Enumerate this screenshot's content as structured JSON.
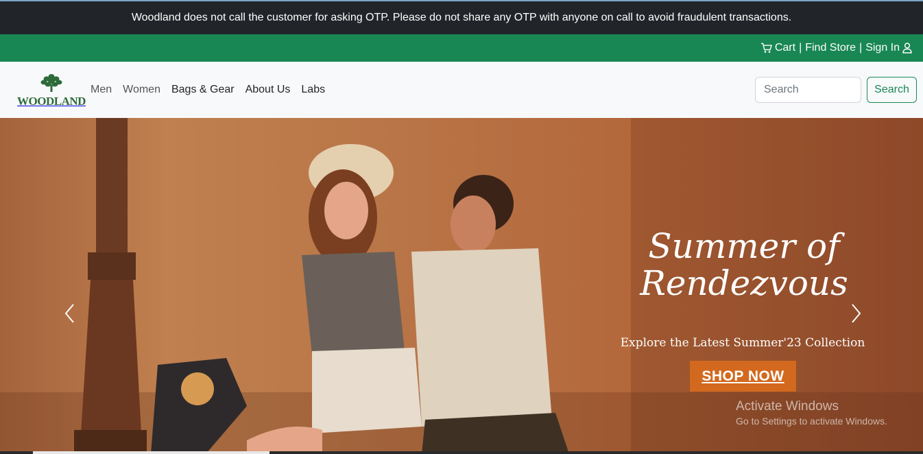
{
  "notice": {
    "text": "Woodland does not call the customer for asking OTP. Please do not share any OTP with anyone on call to avoid fraudulent transactions."
  },
  "account_bar": {
    "cart_label": "Cart",
    "separator": "|",
    "find_store_label": "Find Store",
    "sign_in_label": "Sign In",
    "cart_icon": "cart-icon",
    "user_icon": "user-icon"
  },
  "navbar": {
    "logo_text": "WOODLAND",
    "links": [
      "Men",
      "Women",
      "Bags & Gear",
      "About Us",
      "Labs"
    ]
  },
  "search": {
    "placeholder": "Search",
    "button_label": "Search"
  },
  "carousel": {
    "headline_line1": "Summer of",
    "headline_line2": "Rendezvous",
    "subline": "Explore the Latest Summer'23 Collection",
    "cta_label": "SHOP NOW"
  },
  "watermark": {
    "title": "Activate Windows",
    "subtitle": "Go to Settings to activate Windows."
  },
  "colors": {
    "notice_bg": "#212529",
    "accent_green": "#198754",
    "cta_orange": "#d2691e"
  }
}
